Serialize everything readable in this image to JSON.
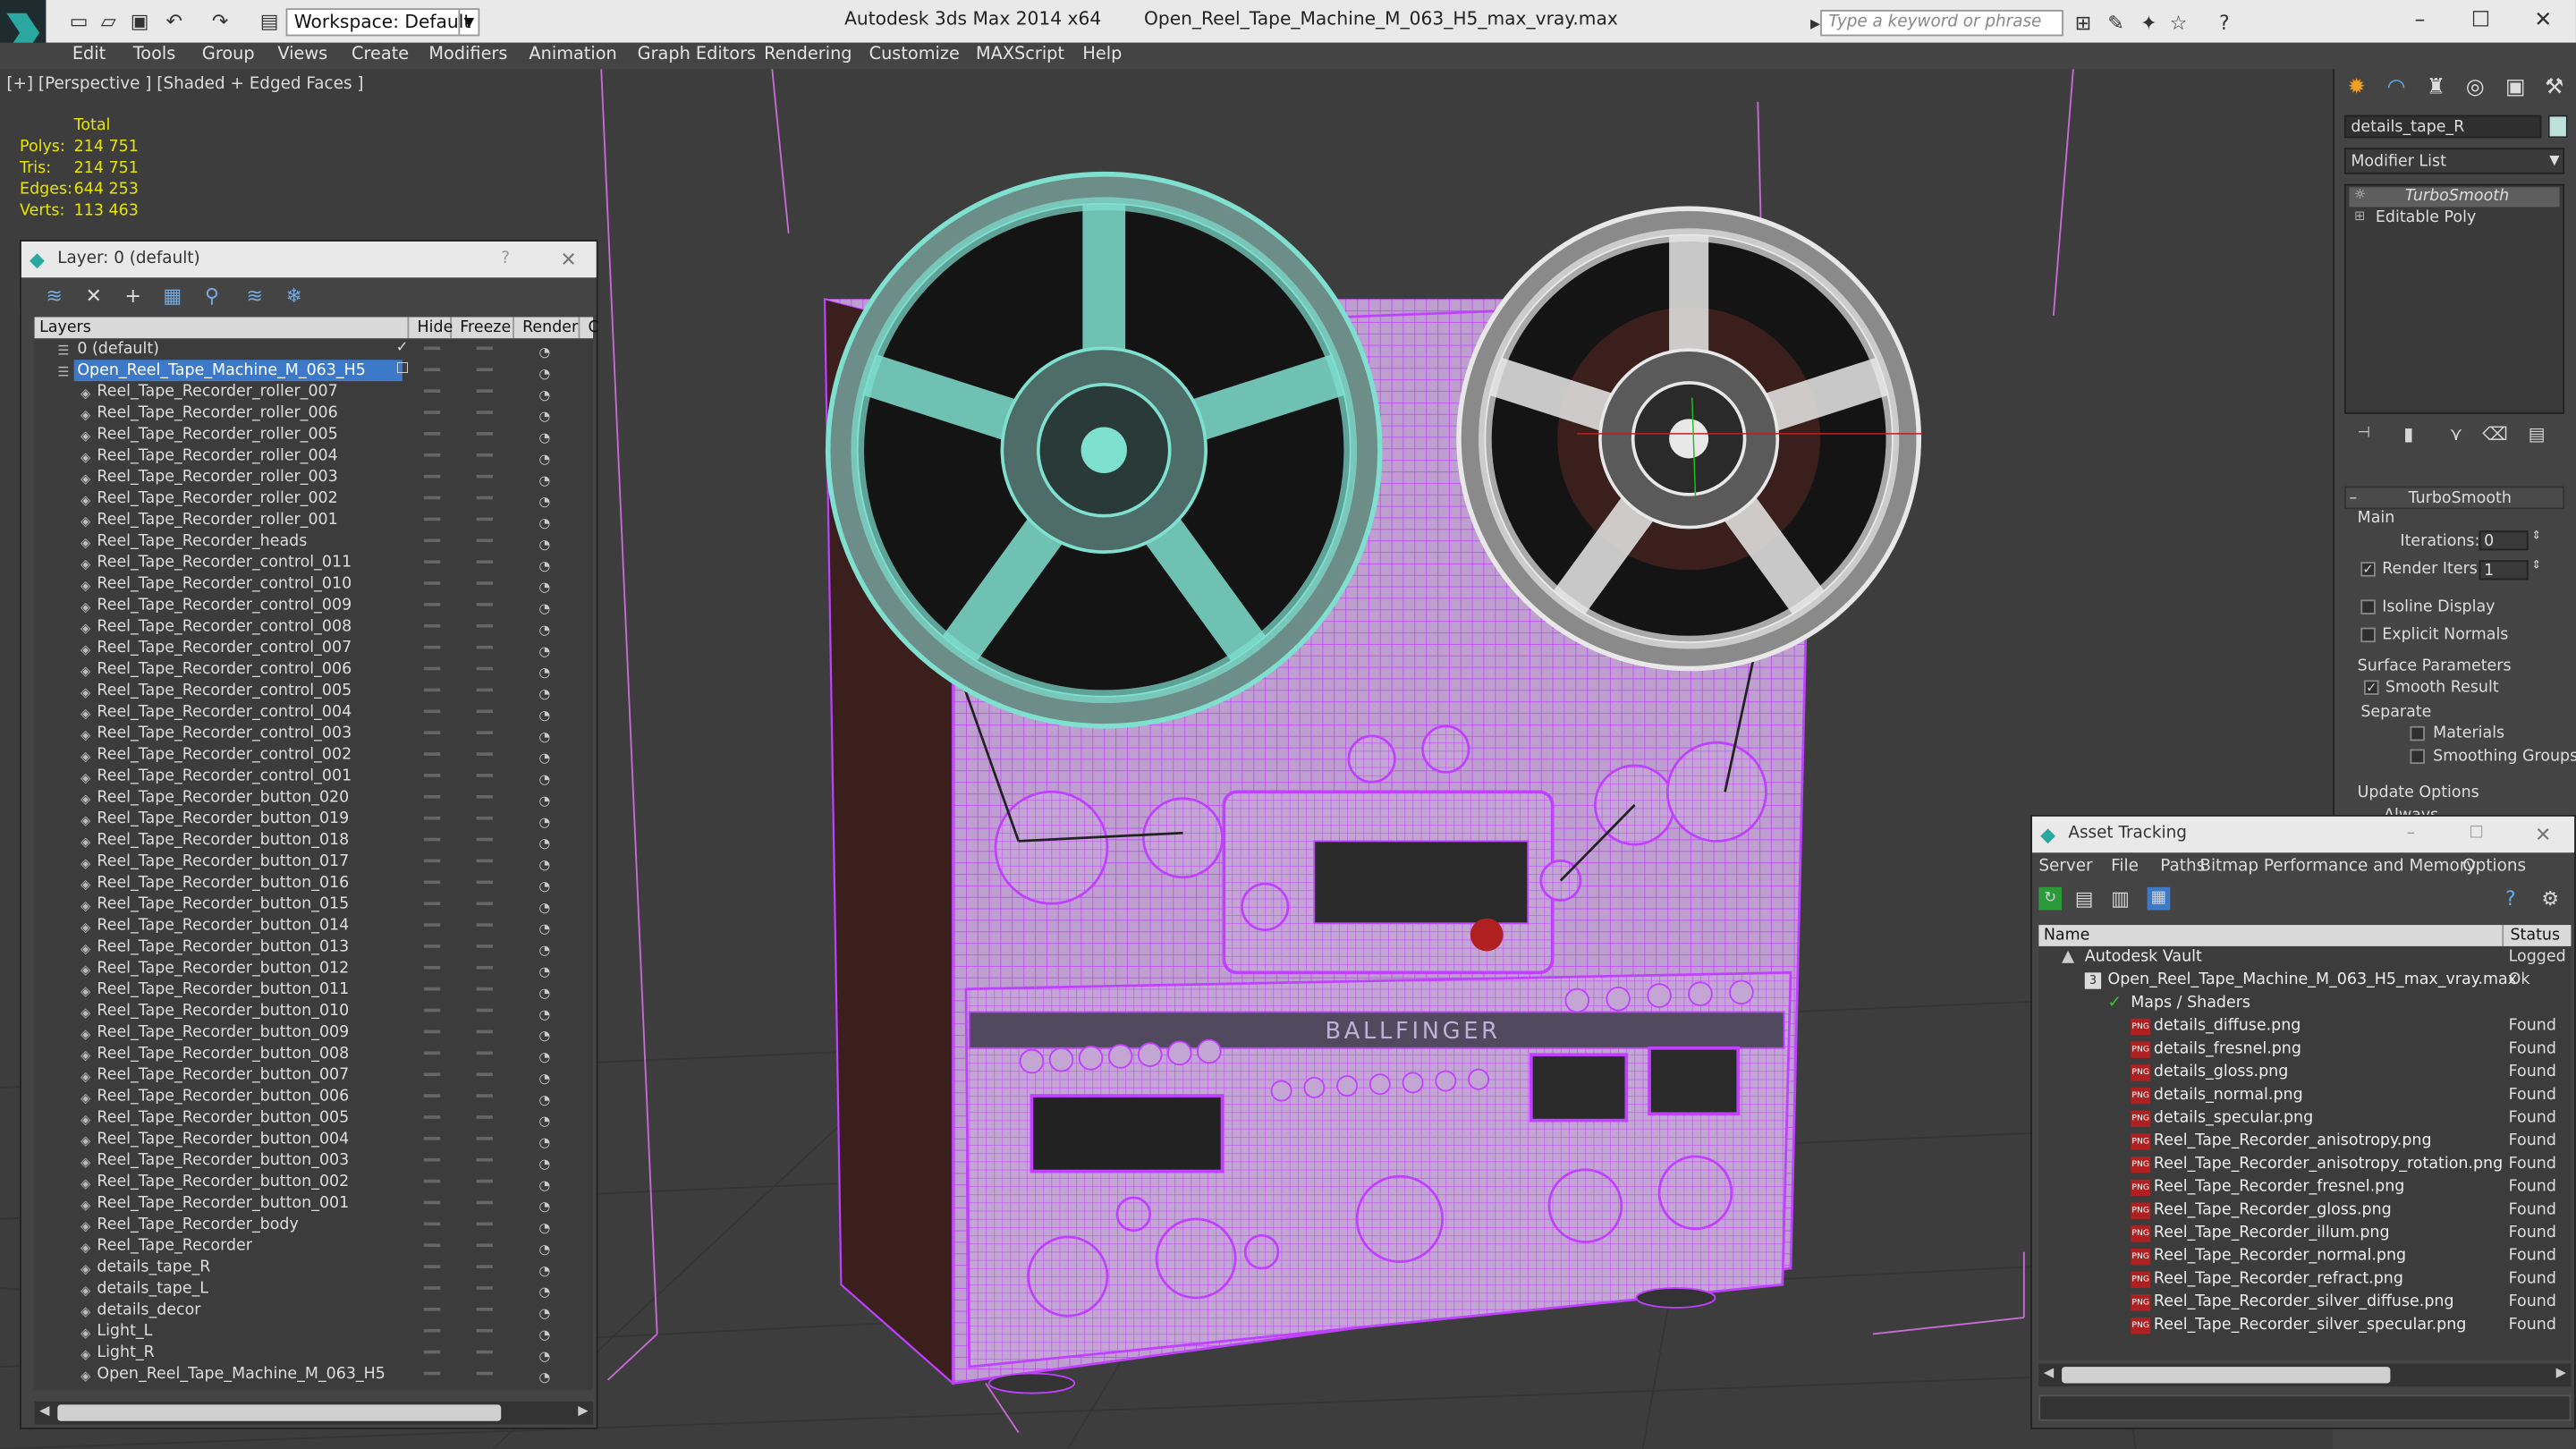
{
  "titlebar": {
    "workspace": "Workspace: Default",
    "app_name": "Autodesk 3ds Max  2014 x64",
    "file_name": "Open_Reel_Tape_Machine_M_063_H5_max_vray.max",
    "search_placeholder": "Type a keyword or phrase"
  },
  "menu": [
    "Edit",
    "Tools",
    "Group",
    "Views",
    "Create",
    "Modifiers",
    "Animation",
    "Graph Editors",
    "Rendering",
    "Customize",
    "MAXScript",
    "Help"
  ],
  "viewport": {
    "label": "[+] [Perspective ] [Shaded + Edged Faces ]",
    "stats": {
      "header": "Total",
      "rows": [
        {
          "k": "Polys:",
          "v": "214 751"
        },
        {
          "k": "Tris:",
          "v": "214 751"
        },
        {
          "k": "Edges:",
          "v": "644 253"
        },
        {
          "k": "Verts:",
          "v": "113 463"
        }
      ]
    },
    "brand_text": "BALLFINGER"
  },
  "layer_panel": {
    "title": "Layer: 0 (default)",
    "help": "?",
    "columns": [
      "Layers",
      "Hide",
      "Freeze",
      "Render",
      "C"
    ],
    "layers": [
      {
        "name": "0 (default)",
        "level": 0
      },
      {
        "name": "Open_Reel_Tape_Machine_M_063_H5",
        "level": 0,
        "selected": true
      },
      {
        "name": "Reel_Tape_Recorder_roller_007",
        "level": 1
      },
      {
        "name": "Reel_Tape_Recorder_roller_006",
        "level": 1
      },
      {
        "name": "Reel_Tape_Recorder_roller_005",
        "level": 1
      },
      {
        "name": "Reel_Tape_Recorder_roller_004",
        "level": 1
      },
      {
        "name": "Reel_Tape_Recorder_roller_003",
        "level": 1
      },
      {
        "name": "Reel_Tape_Recorder_roller_002",
        "level": 1
      },
      {
        "name": "Reel_Tape_Recorder_roller_001",
        "level": 1
      },
      {
        "name": "Reel_Tape_Recorder_heads",
        "level": 1
      },
      {
        "name": "Reel_Tape_Recorder_control_011",
        "level": 1
      },
      {
        "name": "Reel_Tape_Recorder_control_010",
        "level": 1
      },
      {
        "name": "Reel_Tape_Recorder_control_009",
        "level": 1
      },
      {
        "name": "Reel_Tape_Recorder_control_008",
        "level": 1
      },
      {
        "name": "Reel_Tape_Recorder_control_007",
        "level": 1
      },
      {
        "name": "Reel_Tape_Recorder_control_006",
        "level": 1
      },
      {
        "name": "Reel_Tape_Recorder_control_005",
        "level": 1
      },
      {
        "name": "Reel_Tape_Recorder_control_004",
        "level": 1
      },
      {
        "name": "Reel_Tape_Recorder_control_003",
        "level": 1
      },
      {
        "name": "Reel_Tape_Recorder_control_002",
        "level": 1
      },
      {
        "name": "Reel_Tape_Recorder_control_001",
        "level": 1
      },
      {
        "name": "Reel_Tape_Recorder_button_020",
        "level": 1
      },
      {
        "name": "Reel_Tape_Recorder_button_019",
        "level": 1
      },
      {
        "name": "Reel_Tape_Recorder_button_018",
        "level": 1
      },
      {
        "name": "Reel_Tape_Recorder_button_017",
        "level": 1
      },
      {
        "name": "Reel_Tape_Recorder_button_016",
        "level": 1
      },
      {
        "name": "Reel_Tape_Recorder_button_015",
        "level": 1
      },
      {
        "name": "Reel_Tape_Recorder_button_014",
        "level": 1
      },
      {
        "name": "Reel_Tape_Recorder_button_013",
        "level": 1
      },
      {
        "name": "Reel_Tape_Recorder_button_012",
        "level": 1
      },
      {
        "name": "Reel_Tape_Recorder_button_011",
        "level": 1
      },
      {
        "name": "Reel_Tape_Recorder_button_010",
        "level": 1
      },
      {
        "name": "Reel_Tape_Recorder_button_009",
        "level": 1
      },
      {
        "name": "Reel_Tape_Recorder_button_008",
        "level": 1
      },
      {
        "name": "Reel_Tape_Recorder_button_007",
        "level": 1
      },
      {
        "name": "Reel_Tape_Recorder_button_006",
        "level": 1
      },
      {
        "name": "Reel_Tape_Recorder_button_005",
        "level": 1
      },
      {
        "name": "Reel_Tape_Recorder_button_004",
        "level": 1
      },
      {
        "name": "Reel_Tape_Recorder_button_003",
        "level": 1
      },
      {
        "name": "Reel_Tape_Recorder_button_002",
        "level": 1
      },
      {
        "name": "Reel_Tape_Recorder_button_001",
        "level": 1
      },
      {
        "name": "Reel_Tape_Recorder_body",
        "level": 1
      },
      {
        "name": "Reel_Tape_Recorder",
        "level": 1
      },
      {
        "name": "details_tape_R",
        "level": 1
      },
      {
        "name": "details_tape_L",
        "level": 1
      },
      {
        "name": "details_decor",
        "level": 1
      },
      {
        "name": "Light_L",
        "level": 1
      },
      {
        "name": "Light_R",
        "level": 1
      },
      {
        "name": "Open_Reel_Tape_Machine_M_063_H5",
        "level": 1
      }
    ]
  },
  "command_panel": {
    "object_name": "details_tape_R",
    "modifier_list": "Modifier List",
    "stack": [
      "TurboSmooth",
      "Editable Poly"
    ],
    "rollout_title": "TurboSmooth",
    "main_label": "Main",
    "iterations_label": "Iterations:",
    "iterations_value": "0",
    "render_iters_label": "Render Iters:",
    "render_iters_value": "1",
    "isoline": "Isoline Display",
    "explicit_normals": "Explicit Normals",
    "surface_params": "Surface Parameters",
    "smooth_result": "Smooth Result",
    "separate": "Separate",
    "materials": "Materials",
    "smoothing_groups": "Smoothing Groups",
    "update_options": "Update Options",
    "always": "Always"
  },
  "asset_tracking": {
    "title": "Asset Tracking",
    "menu": [
      "Server",
      "File",
      "Paths",
      "Bitmap Performance and Memory",
      "Options"
    ],
    "columns": [
      "Name",
      "Status"
    ],
    "rows": [
      {
        "name": "Autodesk Vault",
        "status": "Logged",
        "level": 0,
        "type": "vault"
      },
      {
        "name": "Open_Reel_Tape_Machine_M_063_H5_max_vray.max",
        "status": "Ok",
        "level": 1,
        "type": "file"
      },
      {
        "name": "Maps / Shaders",
        "status": "",
        "level": 2,
        "type": "folder"
      },
      {
        "name": "details_diffuse.png",
        "status": "Found",
        "level": 3,
        "type": "png"
      },
      {
        "name": "details_fresnel.png",
        "status": "Found",
        "level": 3,
        "type": "png"
      },
      {
        "name": "details_gloss.png",
        "status": "Found",
        "level": 3,
        "type": "png"
      },
      {
        "name": "details_normal.png",
        "status": "Found",
        "level": 3,
        "type": "png"
      },
      {
        "name": "details_specular.png",
        "status": "Found",
        "level": 3,
        "type": "png"
      },
      {
        "name": "Reel_Tape_Recorder_anisotropy.png",
        "status": "Found",
        "level": 3,
        "type": "png"
      },
      {
        "name": "Reel_Tape_Recorder_anisotropy_rotation.png",
        "status": "Found",
        "level": 3,
        "type": "png"
      },
      {
        "name": "Reel_Tape_Recorder_fresnel.png",
        "status": "Found",
        "level": 3,
        "type": "png"
      },
      {
        "name": "Reel_Tape_Recorder_gloss.png",
        "status": "Found",
        "level": 3,
        "type": "png"
      },
      {
        "name": "Reel_Tape_Recorder_illum.png",
        "status": "Found",
        "level": 3,
        "type": "png"
      },
      {
        "name": "Reel_Tape_Recorder_normal.png",
        "status": "Found",
        "level": 3,
        "type": "png"
      },
      {
        "name": "Reel_Tape_Recorder_refract.png",
        "status": "Found",
        "level": 3,
        "type": "png"
      },
      {
        "name": "Reel_Tape_Recorder_silver_diffuse.png",
        "status": "Found",
        "level": 3,
        "type": "png"
      },
      {
        "name": "Reel_Tape_Recorder_silver_specular.png",
        "status": "Found",
        "level": 3,
        "type": "png"
      }
    ]
  },
  "colors": {
    "wire_purple": "#c040ff",
    "reel_teal": "#7fe0d0",
    "reel_white": "#e8e8e8",
    "selection_blue": "#3c79c8",
    "stats_yellow": "#e8e400"
  }
}
